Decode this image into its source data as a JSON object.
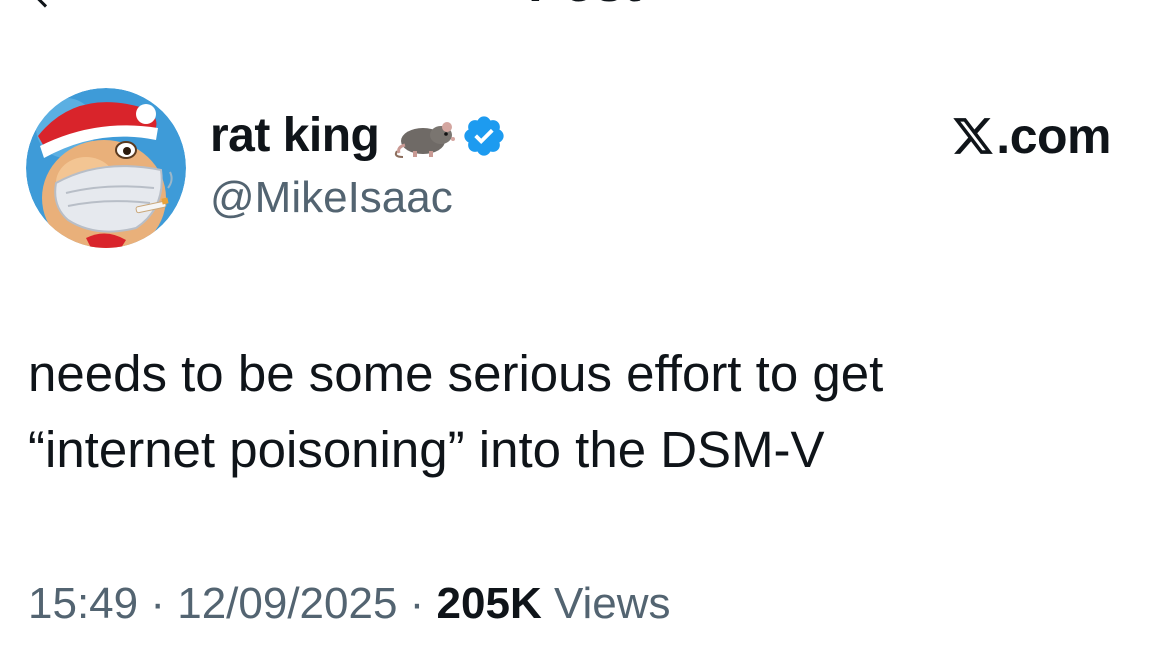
{
  "header": {
    "title": "Post",
    "back_icon": "arrow-left-icon"
  },
  "author": {
    "display_name": "rat king",
    "emoji_icon": "rat-emoji-icon",
    "verified_icon": "verified-badge-icon",
    "handle": "@MikeIsaac",
    "avatar": "avatar-cartoon-santa-hat-mask"
  },
  "source": {
    "logo_icon": "x-logo-icon",
    "text": ".com"
  },
  "post": {
    "text": "needs to be some serious effort to get\n“internet poisoning” into the DSM-V"
  },
  "meta": {
    "time": "15:49",
    "separator": " · ",
    "date": "12/09/2025",
    "views_count": "205K",
    "views_label": " Views"
  },
  "colors": {
    "text_primary": "#0f1419",
    "text_secondary": "#536471",
    "verified_blue": "#1d9bf0"
  }
}
